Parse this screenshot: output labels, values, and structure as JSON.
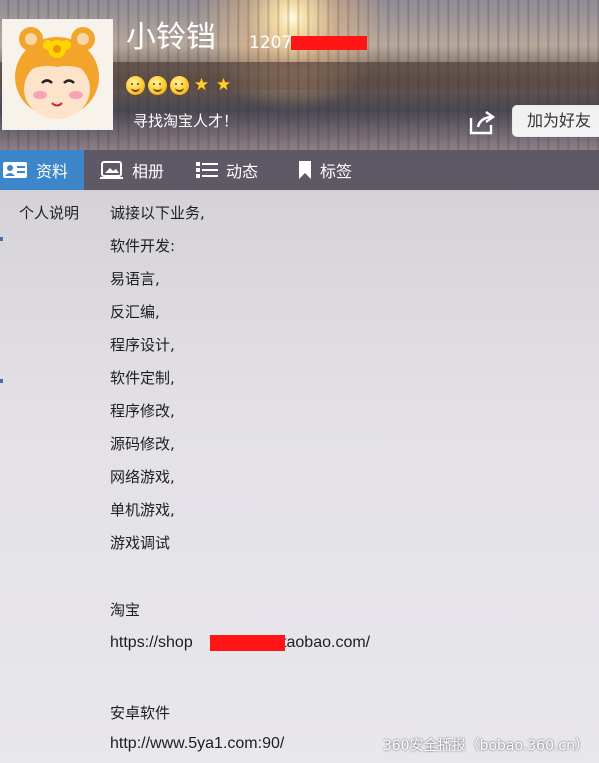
{
  "profile": {
    "nickname": "小铃铛",
    "qq_prefix": "1207",
    "signature": "寻找淘宝人才！",
    "add_friend_label": "加为好友",
    "level_icons": [
      "sun-icon",
      "sun-icon",
      "sun-icon",
      "star-icon",
      "star-icon"
    ]
  },
  "tabs": [
    {
      "label": "资料",
      "icon": "profile-card-icon",
      "active": true
    },
    {
      "label": "相册",
      "icon": "photo-album-icon",
      "active": false
    },
    {
      "label": "动态",
      "icon": "list-icon",
      "active": false
    },
    {
      "label": "标签",
      "icon": "bookmark-icon",
      "active": false
    }
  ],
  "content": {
    "section_label": "个人说明",
    "lines": [
      "诚接以下业务,",
      "软件开发:",
      "易语言,",
      "反汇编,",
      "程序设计,",
      "软件定制,",
      "程序修改,",
      "源码修改,",
      "网络游戏,",
      "单机游戏,",
      "游戏调试"
    ],
    "taobao_heading": "淘宝",
    "taobao_url_prefix": "https://shop",
    "taobao_url_suffix": "3.taobao.com/",
    "android_heading": "安卓软件",
    "android_url": "http://www.5ya1.com:90/"
  },
  "watermark": "360安全播报（bobao.360.cn）",
  "colors": {
    "tab_active": "#3c86c9",
    "redaction": "#ff1515"
  }
}
